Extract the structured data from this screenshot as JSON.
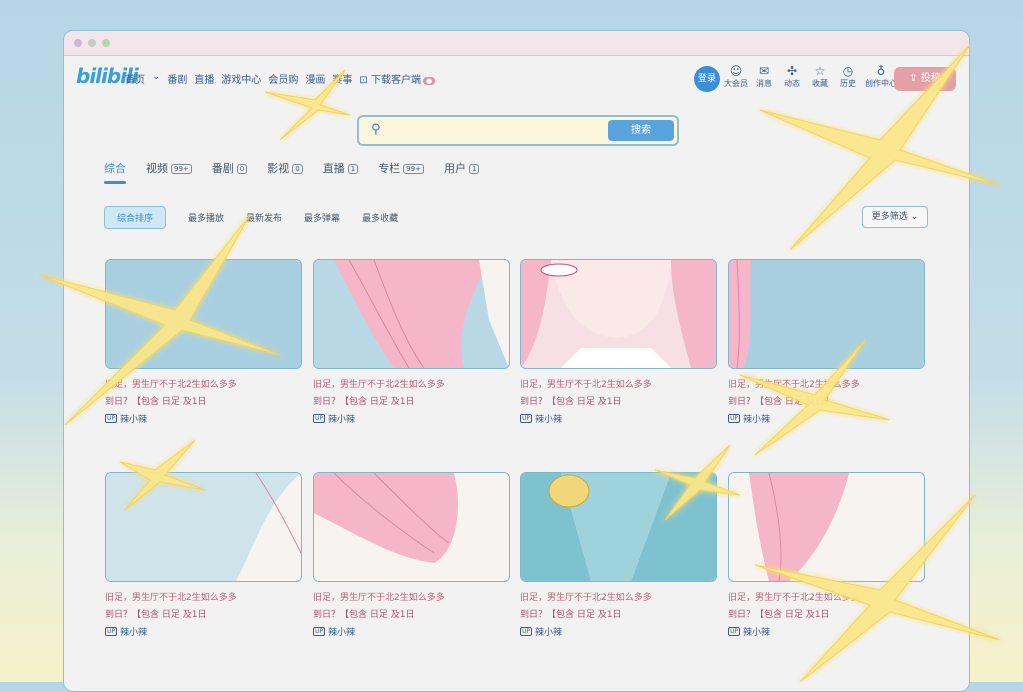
{
  "nav": {
    "logo": "bilibili",
    "links": [
      "首页",
      "番剧",
      "直播",
      "游戏中心",
      "会员购",
      "漫画",
      "赛事",
      "下载客户端"
    ],
    "login": "登录",
    "icons": [
      {
        "label": "大会员",
        "icon": "vip-icon"
      },
      {
        "label": "消息",
        "icon": "message-icon"
      },
      {
        "label": "动态",
        "icon": "dynamic-icon"
      },
      {
        "label": "收藏",
        "icon": "star-icon"
      },
      {
        "label": "历史",
        "icon": "history-icon"
      },
      {
        "label": "创作中心",
        "icon": "lightbulb-icon"
      }
    ],
    "upload": "投稿"
  },
  "search": {
    "placeholder": "",
    "button": "搜索"
  },
  "tabs": [
    {
      "label": "综合",
      "count": ""
    },
    {
      "label": "视频",
      "count": "99+"
    },
    {
      "label": "番剧",
      "count": "0"
    },
    {
      "label": "影视",
      "count": "0"
    },
    {
      "label": "直播",
      "count": "1"
    },
    {
      "label": "专栏",
      "count": "99+"
    },
    {
      "label": "用户",
      "count": "1"
    }
  ],
  "filters": [
    "综合排序",
    "最多播放",
    "最新发布",
    "最多弹幕",
    "最多收藏"
  ],
  "more_filters": "更多筛选",
  "card_title_line1": "旧足，男生厅不于北2生如么多多",
  "card_title_line2": "到日？【包含 日足 及1日",
  "card_uploader": "辣小辣",
  "up_mark": "UP",
  "colors": {
    "accent": "#3a8fd8",
    "pink": "#e3a0a7",
    "card_title": "#c06078"
  }
}
